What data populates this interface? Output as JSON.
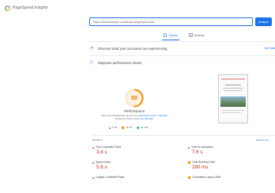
{
  "header": {
    "title": "PageSpeed Insights"
  },
  "search": {
    "url_value": "https://www.example.com/shop/category/product",
    "analyze_label": "Analyze"
  },
  "device_tabs": [
    {
      "label": "Mobile",
      "active": true
    },
    {
      "label": "Desktop",
      "active": false
    }
  ],
  "sections": {
    "real_users": {
      "title": "Discover what your real users are experiencing",
      "link": "No Data"
    },
    "diagnose": {
      "title": "Diagnose performance issues"
    }
  },
  "performance": {
    "score": "50",
    "label": "Performance",
    "note_line1": "Values are estimated and may vary. The",
    "note_link1": "performance score is calculated",
    "note_line2": "directly from these metrics.",
    "note_link2": "See calculator."
  },
  "legend": [
    {
      "shape": "triangle",
      "range": "0–49",
      "color": "#e53935"
    },
    {
      "shape": "square",
      "range": "50–89",
      "color": "#fb8c00"
    },
    {
      "shape": "circle",
      "range": "90–100",
      "color": "#0cce6b"
    }
  ],
  "metrics_header": {
    "title": "METRICS",
    "expand": "Expand view"
  },
  "metrics": [
    {
      "label": "First Contentful Paint",
      "value": "3.4 s",
      "status": "red"
    },
    {
      "label": "Time to Interactive",
      "value": "7.6 s",
      "status": "red"
    },
    {
      "label": "Speed Index",
      "value": "5.8 s",
      "status": "red"
    },
    {
      "label": "Total Blocking Time",
      "value": "290 ms",
      "status": "orange"
    },
    {
      "label": "Largest Contentful Paint",
      "value": "",
      "status": "red"
    },
    {
      "label": "Cumulative Layout Shift",
      "value": "",
      "status": "orange"
    }
  ],
  "colors": {
    "accent": "#1a73e8",
    "score_orange": "#e8710a",
    "fail_red": "#c5221f"
  }
}
